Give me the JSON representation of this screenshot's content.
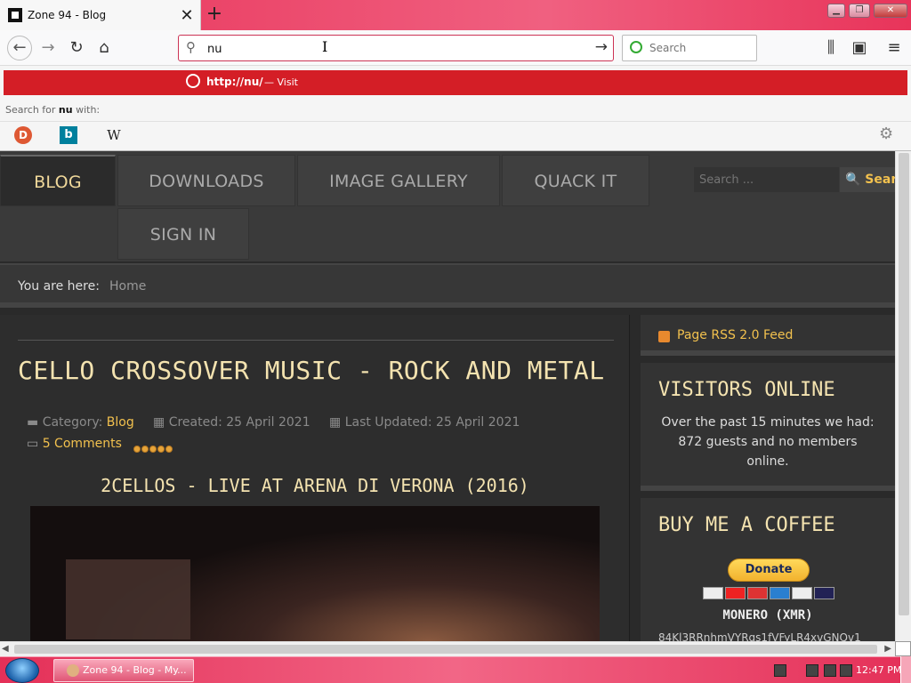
{
  "browser": {
    "tab_title": "Zone 94 - Blog",
    "new_tab": "+",
    "tab_close": "✕",
    "window_min": "▁",
    "window_max": "❐",
    "window_close": "✕",
    "url_value": "nu",
    "search_placeholder": "Search"
  },
  "dropdown": {
    "suggestion_url": "http://nu/",
    "suggestion_action": "— Visit",
    "search_for_prefix": "Search for ",
    "search_for_term": "nu",
    "search_for_suffix": " with:",
    "engines": [
      "duckduckgo-icon",
      "bing-icon",
      "wikipedia-icon"
    ],
    "engine_wiki_glyph": "W",
    "engine_bing_glyph": "b"
  },
  "site": {
    "menu": {
      "blog": "BLOG",
      "downloads": "DOWNLOADS",
      "gallery": "IMAGE GALLERY",
      "quack": "QUACK IT",
      "signin": "SIGN IN"
    },
    "search_placeholder": "Search ...",
    "search_button": "🔍 Search",
    "breadcrumb_label": "You are here:",
    "breadcrumb_home": "Home"
  },
  "article": {
    "title": "CELLO CROSSOVER MUSIC - ROCK AND METAL",
    "category_label": "Category:",
    "category_value": "Blog",
    "created": "Created: 25 April 2021",
    "updated": "Last Updated: 25 April 2021",
    "comments": "5 Comments",
    "rating": 5,
    "video_heading": "2CELLOS - LIVE AT ARENA DI VERONA (2016)"
  },
  "sidebar": {
    "rss_label": "Page RSS 2.0 Feed",
    "visitors_title": "VISITORS ONLINE",
    "visitors_text": "Over the past 15 minutes we had: 872 guests and no members online.",
    "coffee_title": "BUY ME A COFFEE",
    "donate_label": "Donate",
    "monero_title": "MONERO (XMR)",
    "monero_address": "84Kl3RRnhmVYRqs1fVFyLR4xvGNQv1"
  },
  "taskbar": {
    "task_label": "Zone 94 - Blog - My...",
    "clock": "12:47 PM"
  },
  "colors": {
    "accent_gold": "#f2c14e",
    "title_cream": "#f4e3b0",
    "suggestion_red": "#d41e26"
  }
}
